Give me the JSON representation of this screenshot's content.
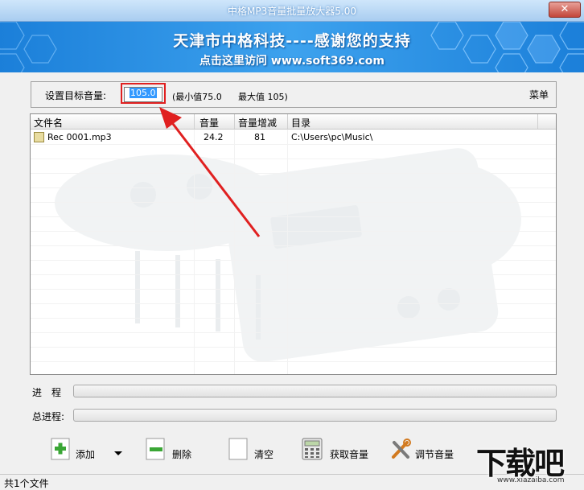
{
  "window": {
    "title": "中格MP3音量批量放大器5.00",
    "close_glyph": "✕"
  },
  "banner": {
    "line1": "天津市中格科技----感谢您的支持",
    "line2": "点击这里访问 www.soft369.com"
  },
  "target_volume": {
    "label": "设置目标音量:",
    "value": "105.0",
    "min_text": "(最小值75.0",
    "max_text": "最大值 105)"
  },
  "menu": {
    "label": "菜单"
  },
  "file_list": {
    "columns": [
      "文件名",
      "音量",
      "音量增减",
      "目录"
    ],
    "rows": [
      {
        "name": "Rec 0001.mp3",
        "volume": "24.2",
        "gain": "81",
        "dir": "C:\\Users\\pc\\Music\\"
      }
    ]
  },
  "progress": {
    "current_label": "进　程",
    "total_label": "总进程:",
    "current_value": 0,
    "total_value": 0
  },
  "toolbar": {
    "add": "添加",
    "delete": "删除",
    "clear": "清空",
    "get_volume": "获取音量",
    "adjust_volume": "调节音量"
  },
  "status": {
    "text": "共1个文件"
  },
  "logo": {
    "text": "下载吧",
    "url": "www.xiazaiba.com"
  },
  "colors": {
    "banner": "#2a90e4",
    "highlight": "#3399ff",
    "annotation": "#e02020"
  }
}
